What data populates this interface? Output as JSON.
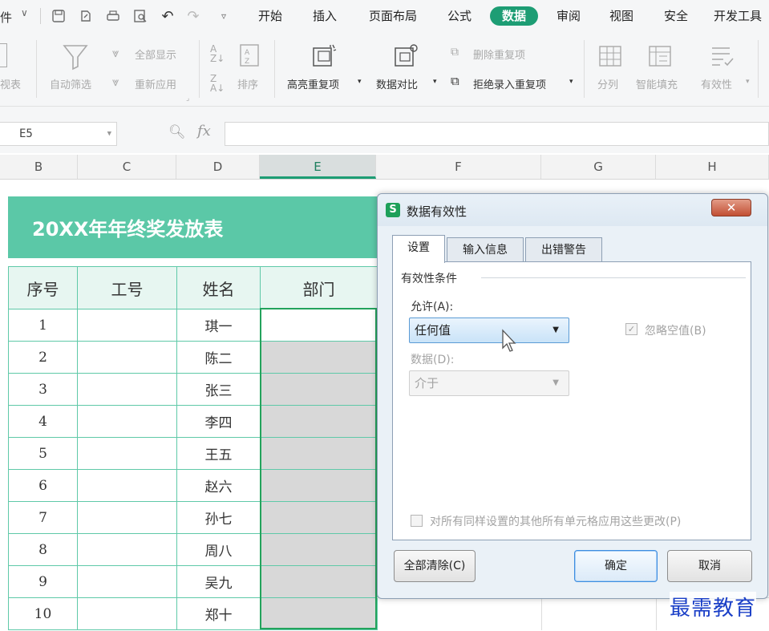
{
  "menubar": {
    "file_partial": "件",
    "tabs": [
      {
        "label": "开始",
        "active": false
      },
      {
        "label": "插入",
        "active": false
      },
      {
        "label": "页面布局",
        "active": false
      },
      {
        "label": "公式",
        "active": false
      },
      {
        "label": "数据",
        "active": true
      },
      {
        "label": "审阅",
        "active": false
      },
      {
        "label": "视图",
        "active": false
      },
      {
        "label": "安全",
        "active": false
      },
      {
        "label": "开发工具",
        "active": false
      }
    ]
  },
  "ribbon": {
    "pivot_partial": "视表",
    "autofilter": "自动筛选",
    "show_all": "全部显示",
    "reapply": "重新应用",
    "sort": "排序",
    "highlight_dup": "高亮重复项",
    "compare": "数据对比",
    "delete_dup": "删除重复项",
    "reject_dup": "拒绝录入重复项",
    "split": "分列",
    "smart_fill": "智能填充",
    "validity": "有效性"
  },
  "formula_bar": {
    "cell_ref": "E5",
    "fx_label": "fx",
    "formula_value": ""
  },
  "columns": [
    "B",
    "C",
    "D",
    "E",
    "F",
    "G",
    "H"
  ],
  "sheet": {
    "title": "20XX年年终奖发放表",
    "headers": [
      "序号",
      "工号",
      "姓名",
      "部门"
    ],
    "rows": [
      {
        "no": "1",
        "id": "",
        "name": "琪一"
      },
      {
        "no": "2",
        "id": "",
        "name": "陈二"
      },
      {
        "no": "3",
        "id": "",
        "name": "张三"
      },
      {
        "no": "4",
        "id": "",
        "name": "李四"
      },
      {
        "no": "5",
        "id": "",
        "name": "王五"
      },
      {
        "no": "6",
        "id": "",
        "name": "赵六"
      },
      {
        "no": "7",
        "id": "",
        "name": "孙七"
      },
      {
        "no": "8",
        "id": "",
        "name": "周八"
      },
      {
        "no": "9",
        "id": "",
        "name": "吴九"
      },
      {
        "no": "10",
        "id": "",
        "name": "郑十"
      }
    ]
  },
  "dialog": {
    "title": "数据有效性",
    "app_icon_glyph": "S",
    "close_glyph": "✕",
    "tabs": [
      {
        "label": "设置",
        "active": true
      },
      {
        "label": "输入信息",
        "active": false
      },
      {
        "label": "出错警告",
        "active": false
      }
    ],
    "group_label": "有效性条件",
    "allow_label": "允许(A):",
    "allow_value": "任何值",
    "data_label": "数据(D):",
    "data_value": "介于",
    "ignore_blank_label": "忽略空值(B)",
    "ignore_blank_checked": true,
    "apply_all_label": "对所有同样设置的其他所有单元格应用这些更改(P)",
    "apply_all_checked": false,
    "clear_all_button": "全部清除(C)",
    "ok_button": "确定",
    "cancel_button": "取消"
  },
  "watermark": "最需教育",
  "colors": {
    "accent": "#1d9d74",
    "title_band": "#5bc8a7",
    "table_border": "#5fc9a8",
    "selection": "#23a35c"
  }
}
